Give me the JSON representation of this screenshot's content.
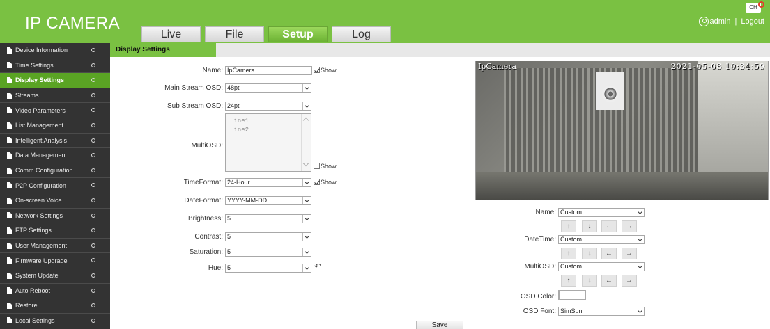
{
  "header": {
    "app_title": "IP CAMERA",
    "tabs": [
      "Live",
      "File",
      "Setup",
      "Log"
    ],
    "active_tab": "Setup",
    "user": "admin",
    "separator": "|",
    "logout_label": "Logout",
    "lang_label": "CH"
  },
  "sidebar": {
    "items": [
      "Device Information",
      "Time Settings",
      "Display Settings",
      "Streams",
      "Video Parameters",
      "List Management",
      "Intelligent Analysis",
      "Data Management",
      "Comm Configuration",
      "P2P Configuration",
      "On-screen Voice",
      "Network Settings",
      "FTP Settings",
      "User Management",
      "Firmware Upgrade",
      "System Update",
      "Auto Reboot",
      "Restore",
      "Local Settings"
    ],
    "active_item": "Display Settings"
  },
  "content": {
    "title": "Display Settings"
  },
  "form": {
    "name_label": "Name:",
    "name_value": "IpCamera",
    "name_show_label": "Show",
    "name_show_checked": true,
    "main_osd_label": "Main Stream OSD:",
    "main_osd_value": "48pt",
    "sub_osd_label": "Sub Stream OSD:",
    "sub_osd_value": "24pt",
    "multiosd_label": "MultiOSD:",
    "multiosd_line1": "Line1",
    "multiosd_line2": "Line2",
    "multiosd_show_label": "Show",
    "multiosd_show_checked": false,
    "timeformat_label": "TimeFormat:",
    "timeformat_value": "24-Hour",
    "timeformat_show_label": "Show",
    "timeformat_show_checked": true,
    "dateformat_label": "DateFormat:",
    "dateformat_value": "YYYY-MM-DD",
    "brightness_label": "Brightness:",
    "brightness_value": "5",
    "contrast_label": "Contrast:",
    "contrast_value": "5",
    "saturation_label": "Saturation:",
    "saturation_value": "5",
    "hue_label": "Hue:",
    "hue_value": "5"
  },
  "video": {
    "osd_name": "IpCamera",
    "osd_time": "2021-05-08 10:34:59"
  },
  "position": {
    "name_label": "Name:",
    "name_value": "Custom",
    "datetime_label": "DateTime:",
    "datetime_value": "Custom",
    "multiosd_label": "MultiOSD:",
    "multiosd_value": "Custom",
    "arrows": [
      "↑",
      "↓",
      "←",
      "→"
    ],
    "osd_color_label": "OSD Color:",
    "osd_color_value": "#ffffff",
    "osd_font_label": "OSD Font:",
    "osd_font_value": "SimSun"
  },
  "save_label": "Save"
}
